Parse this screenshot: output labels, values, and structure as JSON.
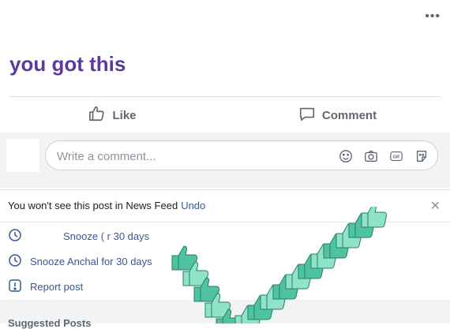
{
  "post": {
    "text": "you got this",
    "more_icon": "more-horizontal-icon"
  },
  "actions": {
    "like_label": "Like",
    "comment_label": "Comment"
  },
  "comment_box": {
    "placeholder": "Write a comment...",
    "icons": [
      "emoji-icon",
      "camera-icon",
      "gif-icon",
      "sticker-icon"
    ]
  },
  "hidden_panel": {
    "message": "You won't see this post in News Feed",
    "undo_label": "Undo",
    "options": [
      {
        "label": "Snooze ( r 30 days",
        "icon": "clock-icon"
      },
      {
        "label": "Snooze Anchal for 30 days",
        "icon": "clock-icon"
      },
      {
        "label": "Report post",
        "icon": "report-icon"
      }
    ]
  },
  "next_section": {
    "title": "Suggested Posts"
  },
  "colors": {
    "post_text": "#5b3a9d",
    "link": "#385898",
    "thumb_overlay": "#4fc3a1"
  }
}
